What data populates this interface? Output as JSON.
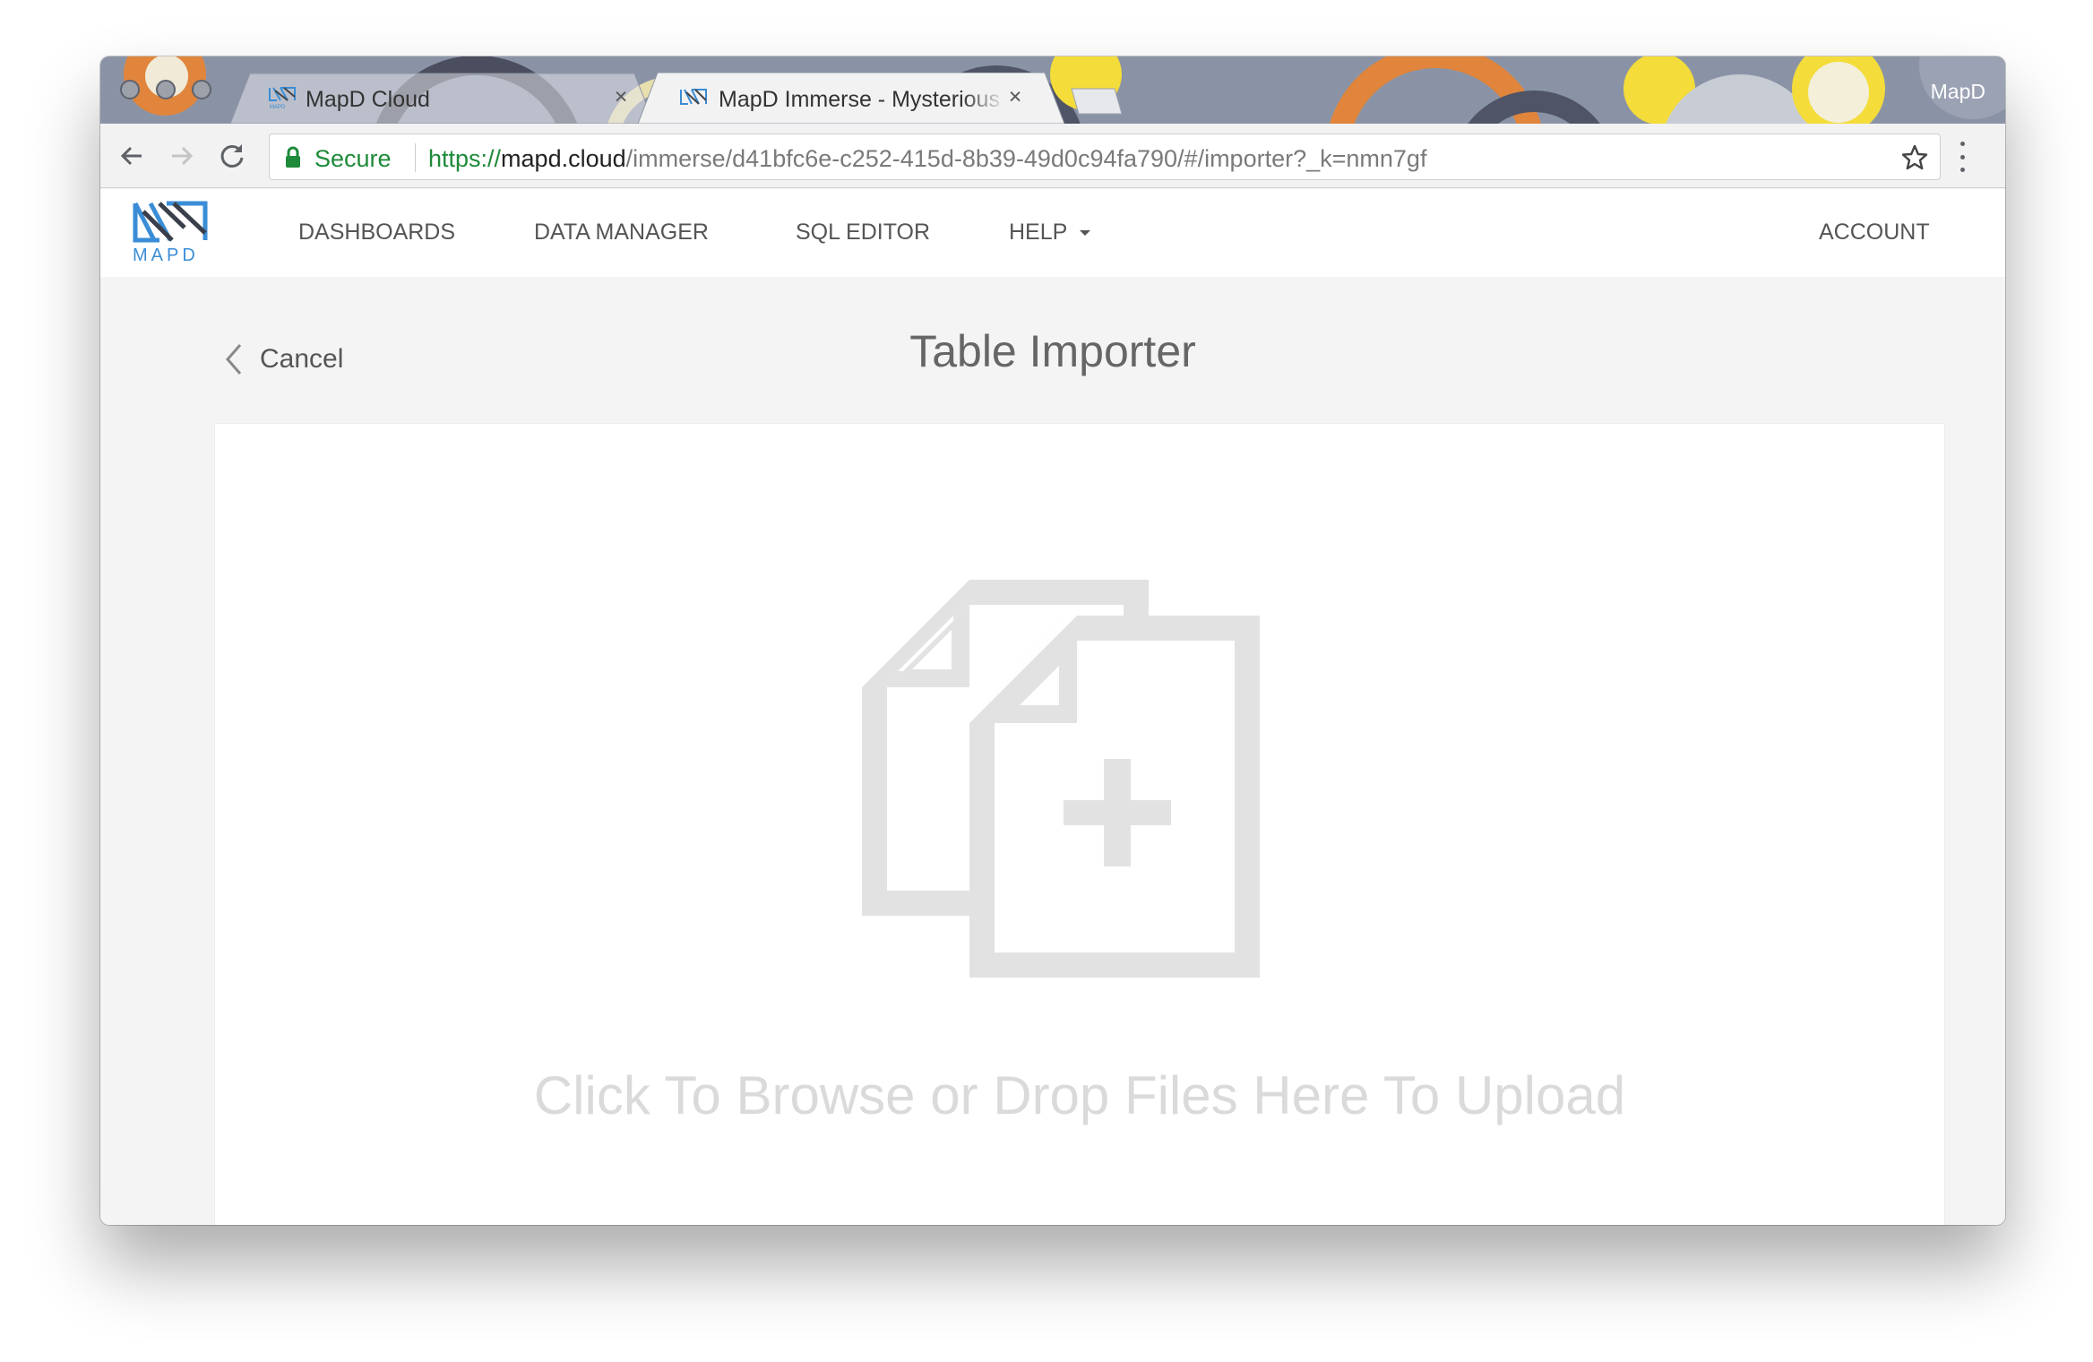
{
  "browser": {
    "profile_name": "MapD",
    "tabs": [
      {
        "title": "MapD Cloud",
        "favicon": "mapd-favicon",
        "active": false
      },
      {
        "title": "MapD Immerse - Mysterious Cl",
        "favicon": "mapd-favicon",
        "active": true
      }
    ],
    "address": {
      "security_label": "Secure",
      "url_scheme": "https://",
      "url_host": "mapd.cloud",
      "url_path": "/immerse/d41bfc6e-c252-415d-8b39-49d0c94fa790/#/importer?_k=nmn7gf"
    }
  },
  "app": {
    "logo_text": "MAPD",
    "nav": {
      "dashboards": "DASHBOARDS",
      "data_manager": "DATA MANAGER",
      "sql_editor": "SQL EDITOR",
      "help": "HELP",
      "account": "ACCOUNT"
    }
  },
  "page": {
    "cancel_label": "Cancel",
    "title": "Table Importer",
    "dropzone_text": "Click To Browse or Drop Files Here To Upload",
    "dropzone_icon": "add-files-icon"
  },
  "colors": {
    "accent": "#3a8dd6",
    "secure_green": "#1e8a3a",
    "tabbar": "#8a93a6"
  }
}
